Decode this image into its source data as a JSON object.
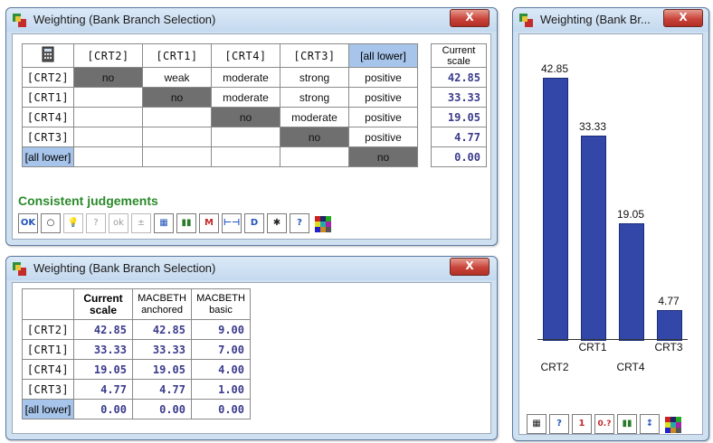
{
  "windows": {
    "matrix": {
      "title": "Weighting (Bank Branch Selection)",
      "close": "X",
      "headers": [
        "[CRT2]",
        "[CRT1]",
        "[CRT4]",
        "[CRT3]",
        "[all lower]"
      ],
      "current_scale_header": "Current scale",
      "rows": [
        {
          "label": "[CRT2]",
          "cells": [
            "no",
            "weak",
            "moderate",
            "strong",
            "positive"
          ],
          "scale": "42.85"
        },
        {
          "label": "[CRT1]",
          "cells": [
            "",
            "no",
            "moderate",
            "strong",
            "positive"
          ],
          "scale": "33.33"
        },
        {
          "label": "[CRT4]",
          "cells": [
            "",
            "",
            "no",
            "moderate",
            "positive"
          ],
          "scale": "19.05"
        },
        {
          "label": "[CRT3]",
          "cells": [
            "",
            "",
            "",
            "no",
            "positive"
          ],
          "scale": "4.77"
        },
        {
          "label": "[all lower]",
          "cells": [
            "",
            "",
            "",
            "",
            "no"
          ],
          "scale": "0.00"
        }
      ],
      "status": "Consistent judgements",
      "toolbar_icons": [
        "ok-check-icon",
        "circle-icon",
        "bulb-icon",
        "bulb-question-icon",
        "bulb-ok-icon",
        "weights-icon",
        "table-export-icon",
        "bar-chart-icon",
        "macbeth-table-icon",
        "interval-icon",
        "diff-icon",
        "person-icon",
        "scale-question-icon",
        "color-mosaic-icon"
      ]
    },
    "scales": {
      "title": "Weighting (Bank Branch Selection)",
      "close": "X",
      "headers": [
        "Current scale",
        "MACBETH anchored",
        "MACBETH basic"
      ],
      "rows": [
        {
          "label": "[CRT2]",
          "values": [
            "42.85",
            "42.85",
            "9.00"
          ]
        },
        {
          "label": "[CRT1]",
          "values": [
            "33.33",
            "33.33",
            "7.00"
          ]
        },
        {
          "label": "[CRT4]",
          "values": [
            "19.05",
            "19.05",
            "4.00"
          ]
        },
        {
          "label": "[CRT3]",
          "values": [
            "4.77",
            "4.77",
            "1.00"
          ]
        },
        {
          "label": "[all lower]",
          "values": [
            "0.00",
            "0.00",
            "0.00"
          ]
        }
      ]
    },
    "chart": {
      "title": "Weighting (Bank Br...",
      "close": "X",
      "toolbar": [
        "table-icon",
        "scale-question-icon",
        "1",
        "0.?",
        "bar-swap-icon",
        "sort-icon",
        "color-mosaic-icon"
      ]
    }
  },
  "chart_data": {
    "type": "bar",
    "categories": [
      "CRT2",
      "CRT1",
      "CRT4",
      "CRT3"
    ],
    "values": [
      42.85,
      33.33,
      19.05,
      4.77
    ],
    "value_labels": [
      "42.85",
      "33.33",
      "19.05",
      "4.77"
    ],
    "ylim": [
      0,
      42.85
    ],
    "grid": false,
    "colors": {
      "bar": "#3247a8"
    }
  },
  "colors": {
    "highlight_cell": "#a7c4ea",
    "dark_cell": "#6f6f6f",
    "consistent_text": "#2c8a2c",
    "scale_number": "#3a3a8c"
  }
}
